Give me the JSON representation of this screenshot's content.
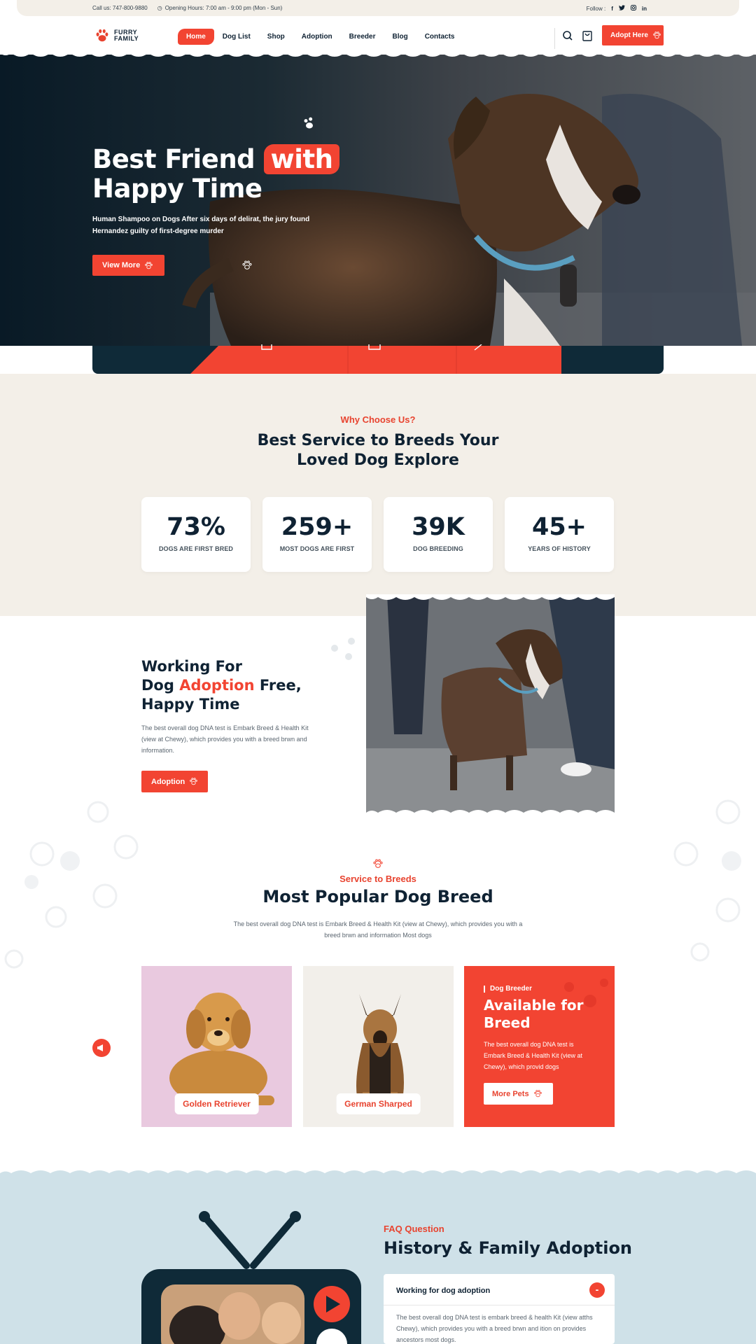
{
  "topbar": {
    "call": "Call us: 747-800-9880",
    "hours": "Opening Hours: 7:00 am - 9:00 pm (Mon - Sun)",
    "follow": "Follow :",
    "social": [
      "f",
      "t",
      "ig",
      "in"
    ]
  },
  "header": {
    "logo_line1": "FURRY",
    "logo_line2": "FAMILY",
    "nav": [
      "Home",
      "Dog List",
      "Shop",
      "Adoption",
      "Breeder",
      "Blog",
      "Contacts"
    ],
    "active_nav": "Home",
    "adopt_button": "Adopt Here"
  },
  "hero": {
    "title_part1": "Best Friend",
    "title_highlight": "with",
    "title_line2": "Happy Time",
    "subtitle": "Human Shampoo on Dogs After six days of delirat, the jury found Hernandez guilty of first-degree murder",
    "button": "View More"
  },
  "why": {
    "eyebrow": "Why Choose Us?",
    "title_line1": "Best Service to Breeds Your",
    "title_line2": "Loved Dog Explore",
    "stats": [
      {
        "value": "73%",
        "label": "DOGS ARE FIRST BRED"
      },
      {
        "value": "259+",
        "label": "MOST DOGS ARE FIRST"
      },
      {
        "value": "39K",
        "label": "DOG BREEDING"
      },
      {
        "value": "45+",
        "label": "YEARS OF HISTORY"
      }
    ]
  },
  "working": {
    "line1": "Working For",
    "line2_a": "Dog ",
    "line2_hl": "Adoption",
    "line2_b": " Free,",
    "line3": "Happy Time",
    "text": "The best overall dog DNA test is Embark Breed & Health Kit (view at Chewy), which provides you with a breed brwn and information.",
    "button": "Adoption"
  },
  "popular": {
    "eyebrow": "Service to Breeds",
    "title": "Most Popular Dog Breed",
    "text": "The best overall dog DNA test is Embark Breed & Health Kit (view at Chewy), which provides you with a breed brwn and information Most dogs",
    "cards": [
      {
        "label": "Golden Retriever"
      },
      {
        "label": "German Sharped"
      }
    ],
    "available": {
      "eyebrow": "Dog Breeder",
      "title": "Available for Breed",
      "text": "The best overall dog DNA test is Embark Breed & Health Kit (view at Chewy), which provid dogs",
      "button": "More Pets"
    }
  },
  "faq": {
    "eyebrow": "FAQ Question",
    "title": "History & Family Adoption",
    "question": "Working for dog adoption",
    "toggle": "-",
    "answer": "The best overall dog DNA test is embark breed & health Kit (view atths Chewy), which provides you with a breed brwn and ition on provides ancestors most dogs."
  },
  "colors": {
    "accent": "#f24432",
    "navy": "#0f2233",
    "beige": "#f3efe8",
    "light_blue": "#cfe1e8"
  }
}
